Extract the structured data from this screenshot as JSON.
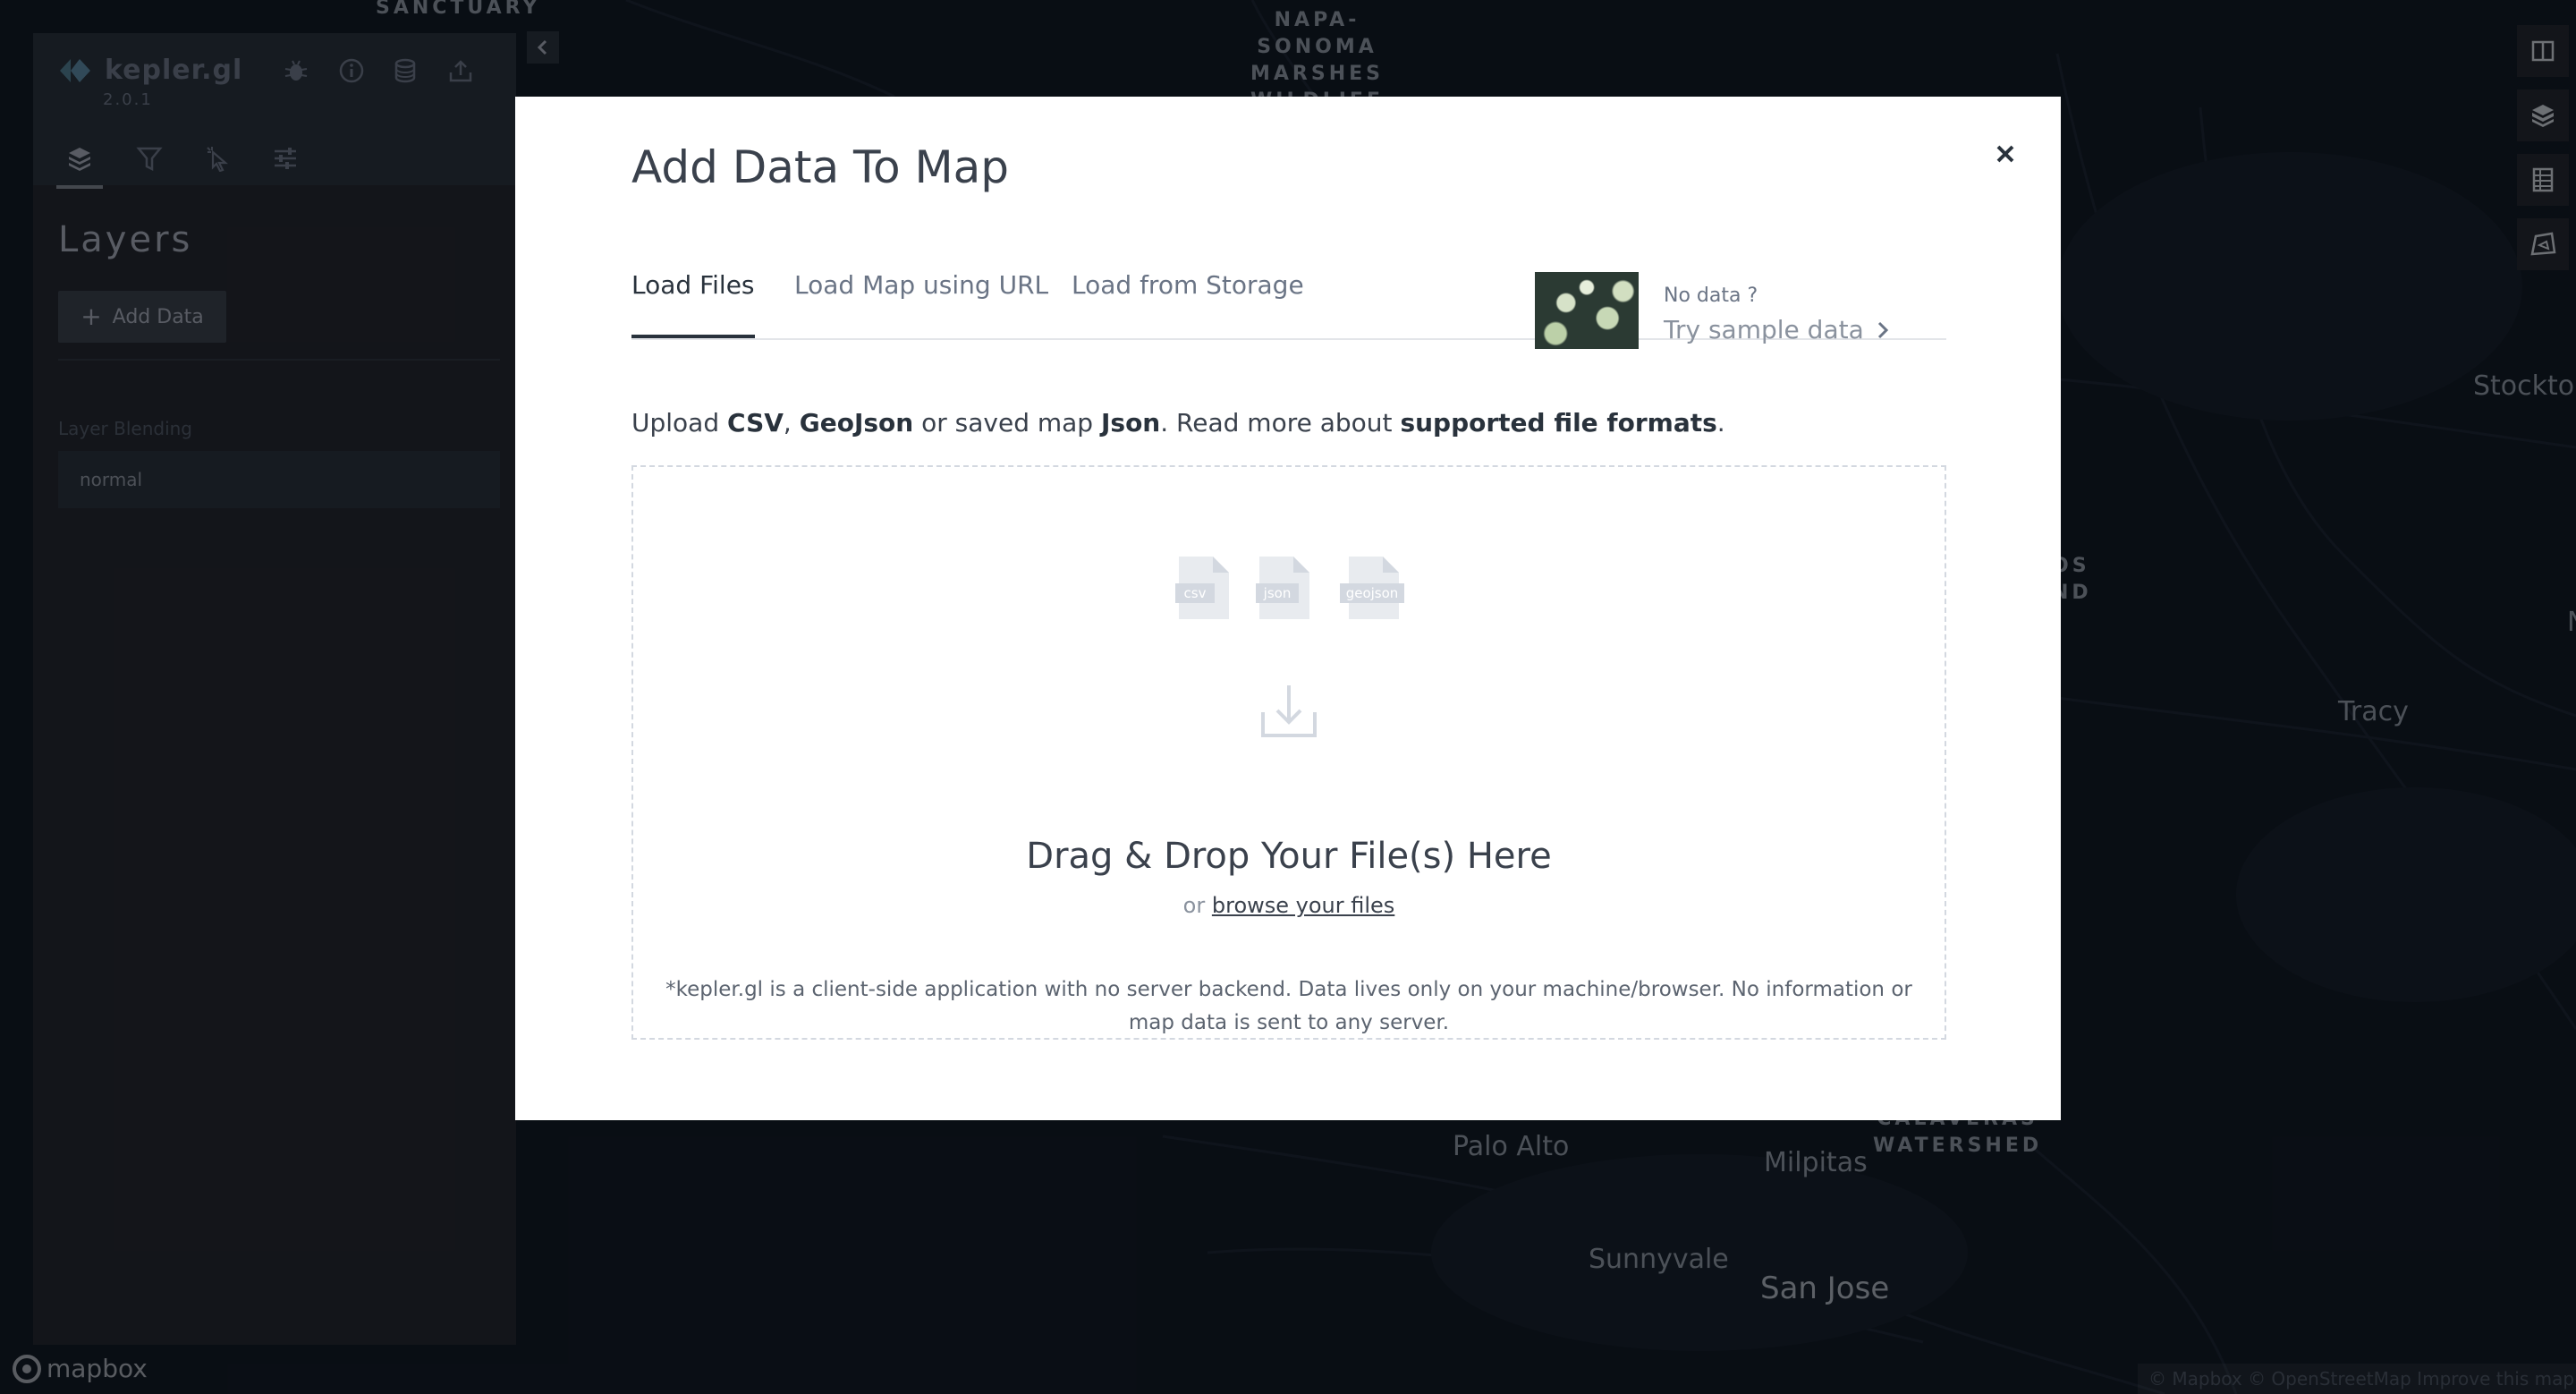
{
  "map": {
    "labels": {
      "sanctuary": "SANCTUARY",
      "napa_sonoma": "NAPA-\nSONOMA\nMARSHES\nWILDLIFE",
      "stockton": "Stockton",
      "tracy": "Tracy",
      "palo_alto": "Palo Alto",
      "milpitas": "Milpitas",
      "calaveras": "CALAVERAS\nWATERSHED",
      "sunnyvale": "Sunnyvale",
      "san_jose": "San Jose",
      "edge_os": "OS",
      "edge_nd": "ND",
      "edge_n": "N"
    },
    "attribution": "© Mapbox © OpenStreetMap Improve this map",
    "mapbox_logo": "mapbox"
  },
  "side_panel": {
    "logo_text": "kepler.gl",
    "version": "2.0.1",
    "title": "Layers",
    "add_data_label": "Add Data",
    "layer_blending_label": "Layer Blending",
    "layer_blending_value": "normal"
  },
  "modal": {
    "title": "Add Data To Map",
    "tabs": [
      {
        "label": "Load Files"
      },
      {
        "label": "Load Map using URL"
      },
      {
        "label": "Load from Storage"
      }
    ],
    "no_data_label": "No data ?",
    "try_sample_label": "Try sample data",
    "upload": {
      "prefix": "Upload ",
      "csv": "CSV",
      "comma": ", ",
      "geojson": "GeoJson",
      "middle": " or saved map ",
      "json": "Json",
      "read_more": ". Read more about ",
      "formats": "supported file formats",
      "end": "."
    },
    "file_types": [
      "csv",
      "json",
      "geojson"
    ],
    "drop_title": "Drag & Drop Your File(s) Here",
    "or_label": "or",
    "browse_label": "browse your files",
    "disclaimer": "*kepler.gl is a client-side application with no server backend. Data lives only on your machine/browser. No information or map data is sent to any server."
  },
  "colors": {
    "map_bg": "#121a26",
    "panel_bg": "#242730",
    "modal_bg": "#ffffff",
    "text_dark": "#3a414c"
  }
}
